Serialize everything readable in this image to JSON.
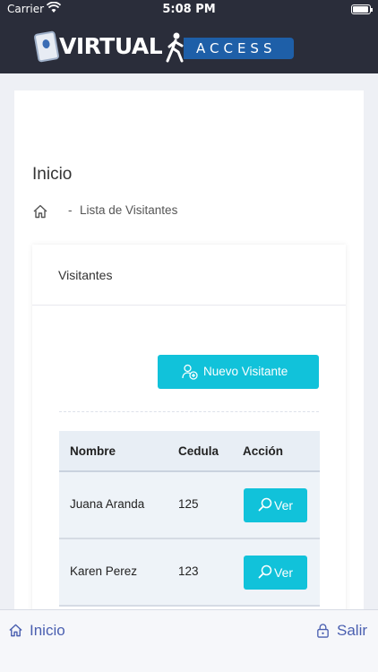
{
  "status_bar": {
    "carrier": "Carrier",
    "time": "5:08 PM"
  },
  "header": {
    "logo_text_1": "VIRTUAL",
    "logo_text_2": "ACCESS"
  },
  "page": {
    "title": "Inicio",
    "breadcrumb": {
      "separator": "-",
      "current": "Lista de Visitantes"
    }
  },
  "card": {
    "title": "Visitantes",
    "new_button_label": "Nuevo Visitante",
    "table": {
      "headers": [
        "Nombre",
        "Cedula",
        "Acción"
      ],
      "rows": [
        {
          "nombre": "Juana Aranda",
          "cedula": "125",
          "action": "Ver"
        },
        {
          "nombre": "Karen Perez",
          "cedula": "123",
          "action": "Ver"
        }
      ]
    }
  },
  "tabbar": {
    "home_label": "Inicio",
    "logout_label": "Salir"
  },
  "colors": {
    "accent": "#11c2da",
    "header_bg": "#2a2d3a",
    "tab_color": "#4a5fb0"
  }
}
